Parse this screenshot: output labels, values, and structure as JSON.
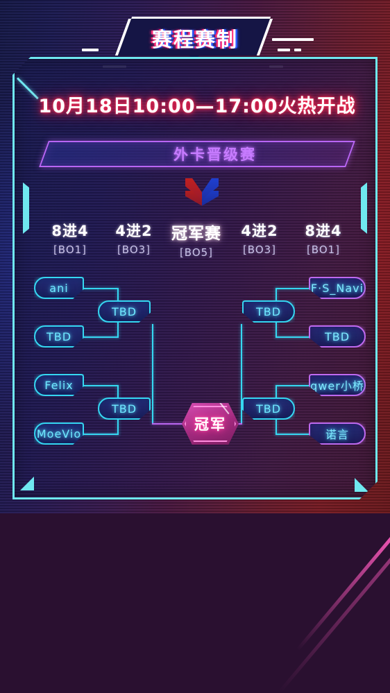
{
  "header": {
    "title": "赛程赛制",
    "date_line": "10月18日10:00—17:00火热开战",
    "subtitle": "外卡晋级赛"
  },
  "rounds": [
    {
      "name": "8进4",
      "bo": "[BO1]"
    },
    {
      "name": "4进2",
      "bo": "[BO3]"
    },
    {
      "name": "冠军赛",
      "bo": "[BO5]"
    },
    {
      "name": "4进2",
      "bo": "[BO3]"
    },
    {
      "name": "8进4",
      "bo": "[BO1]"
    }
  ],
  "bracket": {
    "left": {
      "quarterfinals": [
        {
          "team": "ani"
        },
        {
          "team": "TBD"
        },
        {
          "team": "Felix"
        },
        {
          "team": "MoeVio"
        }
      ],
      "semifinals": [
        {
          "team": "TBD"
        },
        {
          "team": "TBD"
        }
      ]
    },
    "right": {
      "quarterfinals": [
        {
          "team": "F·S_Navi"
        },
        {
          "team": "TBD"
        },
        {
          "team": "qwer小桥"
        },
        {
          "team": "诺言"
        }
      ],
      "semifinals": [
        {
          "team": "TBD"
        },
        {
          "team": "TBD"
        }
      ]
    },
    "champion": {
      "label": "冠军"
    }
  },
  "colors": {
    "neon_cyan": "#36d8f2",
    "neon_magenta": "#d94fb4",
    "neon_purple": "#b966f5",
    "date_red": "#ff2a52",
    "frame_border": "#6fe8f0"
  }
}
